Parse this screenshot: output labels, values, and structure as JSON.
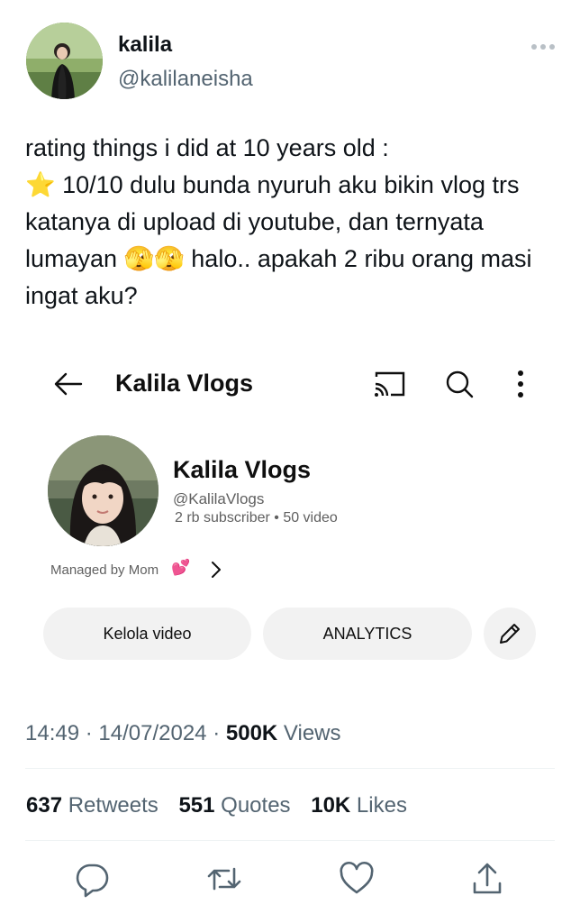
{
  "author": {
    "name": "kalila",
    "handle": "@kalilaneisha"
  },
  "tweet": {
    "text": "rating things i did at 10 years old :\n⭐ 10/10 dulu bunda nyuruh aku bikin vlog trs katanya di upload di youtube, dan ternyata lumayan 🫣🫣 halo.. apakah 2 ribu orang masi ingat aku?"
  },
  "embed": {
    "title": "Kalila Vlogs",
    "channel_name": "Kalila Vlogs",
    "channel_handle": "@KalilaVlogs",
    "channel_meta": "2 rb subscriber • 50 video",
    "managed_by": "Managed by Mom",
    "managed_emoji": "💕",
    "buttons": {
      "manage": "Kelola video",
      "analytics": "ANALYTICS"
    }
  },
  "meta": {
    "time": "14:49",
    "date": "14/07/2024",
    "views_count": "500K",
    "views_label": "Views",
    "separator": "·"
  },
  "stats": {
    "retweets_count": "637",
    "retweets_label": "Retweets",
    "quotes_count": "551",
    "quotes_label": "Quotes",
    "likes_count": "10K",
    "likes_label": "Likes"
  },
  "icons": {
    "more": "more-horizontal-icon",
    "back": "arrow-left-icon",
    "cast": "cast-icon",
    "search": "search-icon",
    "menu": "more-vertical-icon",
    "edit": "pencil-icon",
    "reply": "reply-icon",
    "retweet": "retweet-icon",
    "like": "heart-icon",
    "share": "share-icon"
  },
  "colors": {
    "text": "#0f1419",
    "secondary": "#536471",
    "pill": "#f2f2f2"
  }
}
